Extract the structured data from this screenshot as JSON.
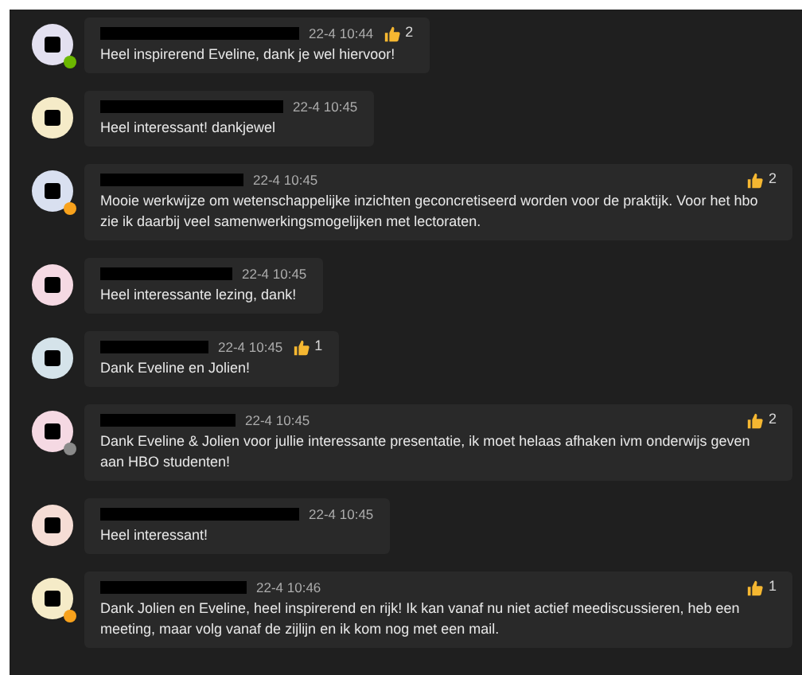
{
  "messages": [
    {
      "kind": "compact",
      "color": "#e3e0f0",
      "presence": {
        "color": "#6bb700"
      },
      "time": "22-4 10:44",
      "likes": "2",
      "text": "Heel inspirerend Eveline, dank je wel hiervoor!"
    },
    {
      "kind": "compact",
      "color": "#f5ebc8",
      "time": "22-4 10:45",
      "text": "Heel interessant! dankjewel"
    },
    {
      "kind": "wide",
      "color": "#d9e0f0",
      "presence": {
        "color": "#f8a21c"
      },
      "time": "22-4 10:45",
      "likes": "2",
      "text": "Mooie werkwijze om wetenschappelijke inzichten geconcretiseerd worden voor de praktijk. Voor het hbo zie ik daarbij veel samenwerkingsmogelijken met lectoraten."
    },
    {
      "kind": "compact",
      "color": "#f5d9e3",
      "time": "22-4 10:45",
      "text": "Heel interessante lezing, dank!"
    },
    {
      "kind": "compact",
      "color": "#d5e3ea",
      "time": "22-4 10:45",
      "likes": "1",
      "text": "Dank Eveline en Jolien!"
    },
    {
      "kind": "wide",
      "color": "#f5d9e3",
      "presence": {
        "color": "#8a8a8a"
      },
      "time": "22-4 10:45",
      "likes": "2",
      "text": "Dank Eveline & Jolien voor jullie interessante presentatie, ik moet helaas afhaken ivm onderwijs geven aan HBO studenten!"
    },
    {
      "kind": "compact",
      "color": "#f5ddd5",
      "time": "22-4 10:45",
      "text": "Heel interessant!"
    },
    {
      "kind": "wide",
      "color": "#f5ebc8",
      "presence": {
        "color": "#f8a21c"
      },
      "time": "22-4 10:46",
      "likes": "1",
      "text": "Dank Jolien en Eveline, heel inspirerend en rijk! Ik kan vanaf nu niet actief meediscussieren, heb een meeting, maar volg vanaf de zijlijn en ik kom nog met een mail."
    }
  ]
}
